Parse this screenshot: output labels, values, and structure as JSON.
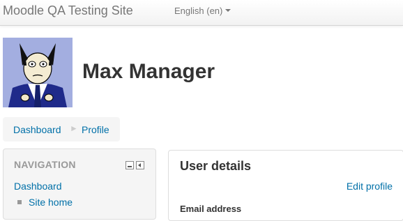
{
  "navbar": {
    "brand": "Moodle QA Testing Site",
    "language": "English (en)"
  },
  "user": {
    "name": "Max Manager"
  },
  "breadcrumb": {
    "items": [
      "Dashboard",
      "Profile"
    ],
    "separator": "►"
  },
  "navigation": {
    "title": "NAVIGATION",
    "dashboard": "Dashboard",
    "site_home": "Site home"
  },
  "user_details": {
    "title": "User details",
    "edit_profile": "Edit profile",
    "email_label": "Email address"
  },
  "colors": {
    "link": "#0070a8",
    "muted": "#999999",
    "panel": "#f5f5f5"
  }
}
